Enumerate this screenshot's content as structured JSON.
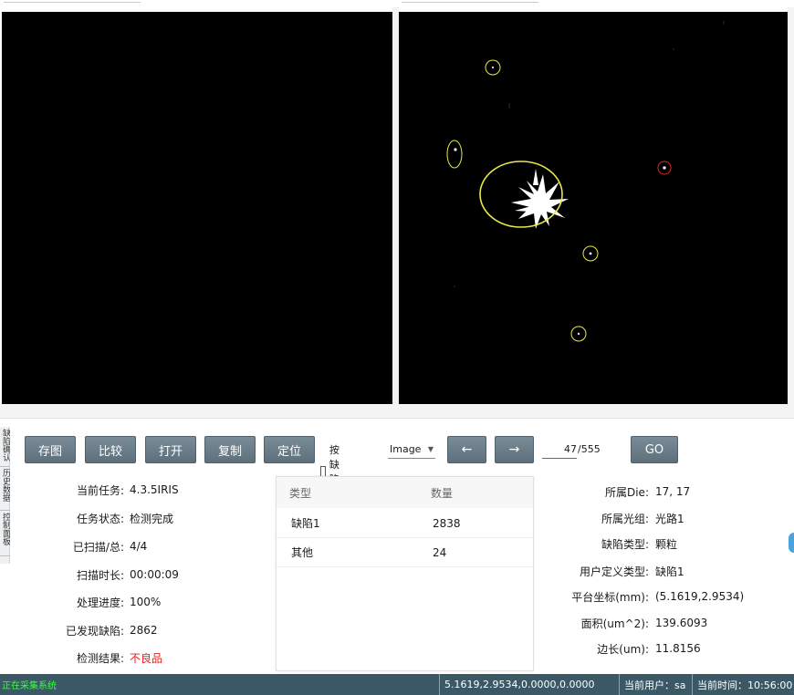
{
  "toolbar": {
    "buttons": [
      "存图",
      "比较",
      "打开",
      "复制",
      "定位"
    ],
    "checkbox_label": "按缺陷图",
    "select_value": "Image",
    "prev_label": "←",
    "next_label": "→",
    "page_current": "47",
    "page_total": "/555",
    "go_label": "GO"
  },
  "side_tabs": [
    "缺陷确认",
    "历史数据",
    "控制面板"
  ],
  "task_info": [
    {
      "label": "当前任务:",
      "value": "4.3.5IRIS"
    },
    {
      "label": "任务状态:",
      "value": "检测完成"
    },
    {
      "label": "已扫描/总:",
      "value": "4/4"
    },
    {
      "label": "扫描时长:",
      "value": "00:00:09"
    },
    {
      "label": "处理进度:",
      "value": "100%"
    },
    {
      "label": "已发现缺陷:",
      "value": "2862"
    },
    {
      "label": "检测结果:",
      "value": "不良品"
    }
  ],
  "defect_table": {
    "headers": [
      "类型",
      "数量"
    ],
    "rows": [
      [
        "缺陷1",
        "2838"
      ],
      [
        "其他",
        "24"
      ]
    ]
  },
  "defect_detail": [
    {
      "label": "所属Die:",
      "value": "17, 17"
    },
    {
      "label": "所属光组:",
      "value": "光路1"
    },
    {
      "label": "缺陷类型:",
      "value": "颗粒"
    },
    {
      "label": "用户定义类型:",
      "value": "缺陷1"
    },
    {
      "label": "平台坐标(mm):",
      "value": "(5.1619,2.9534)"
    },
    {
      "label": "面积(um^2):",
      "value": "139.6093"
    },
    {
      "label": "边长(um):",
      "value": "11.8156"
    }
  ],
  "statusbar": {
    "left_status": "正在采集系统",
    "coords": "5.1619,2.9534,0.0000,0.0000",
    "user_label": "当前用户：sa",
    "time_label": "当前时间：10:56:00"
  },
  "colors": {
    "button_bg": "#6b7c89",
    "result_bad": "#e02020",
    "statusbar_bg": "#3a5866",
    "status_green": "#39ff3a",
    "marker_yellow": "#e8e84a",
    "marker_red": "#d92a2a"
  }
}
